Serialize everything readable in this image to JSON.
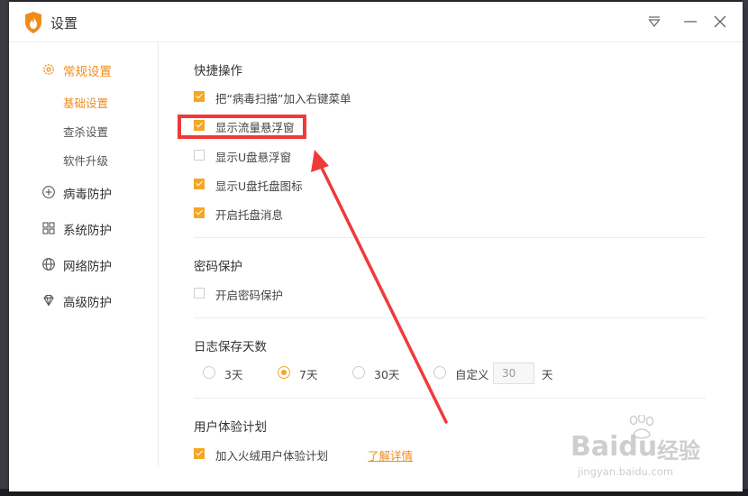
{
  "window": {
    "title": "设置"
  },
  "titlebar": {
    "menu_icon": "dropdown-menu-icon",
    "minimize_icon": "minimize-icon",
    "close_icon": "close-icon"
  },
  "sidebar": {
    "items": [
      {
        "label": "常规设置",
        "icon": "gear-icon",
        "active": true
      },
      {
        "label": "病毒防护",
        "icon": "plus-circle-icon"
      },
      {
        "label": "系统防护",
        "icon": "grid-icon"
      },
      {
        "label": "网络防护",
        "icon": "globe-icon"
      },
      {
        "label": "高级防护",
        "icon": "diamond-icon"
      }
    ],
    "subitems": [
      {
        "label": "基础设置",
        "active": true
      },
      {
        "label": "查杀设置"
      },
      {
        "label": "软件升级"
      }
    ]
  },
  "quick_ops": {
    "title": "快捷操作",
    "items": [
      {
        "label": "把“病毒扫描”加入右键菜单",
        "checked": true
      },
      {
        "label": "显示流量悬浮窗",
        "checked": true
      },
      {
        "label": "显示U盘悬浮窗",
        "checked": false
      },
      {
        "label": "显示U盘托盘图标",
        "checked": true
      },
      {
        "label": "开启托盘消息",
        "checked": true
      }
    ]
  },
  "password": {
    "title": "密码保护",
    "items": [
      {
        "label": "开启密码保护",
        "checked": false
      }
    ]
  },
  "log_days": {
    "title": "日志保存天数",
    "options": [
      {
        "label": "3天",
        "selected": false
      },
      {
        "label": "7天",
        "selected": true
      },
      {
        "label": "30天",
        "selected": false
      },
      {
        "label": "自定义",
        "selected": false
      }
    ],
    "custom_value": "30",
    "unit": "天"
  },
  "ux_plan": {
    "title": "用户体验计划",
    "items": [
      {
        "label": "加入火绒用户体验计划",
        "checked": true
      }
    ],
    "link": "了解详情"
  },
  "annotation": {
    "color": "#f03a3a"
  },
  "watermark": {
    "brand": "Baidu",
    "label": "经验",
    "url": "jingyan.baidu.com"
  },
  "colors": {
    "accent": "#f08c1a",
    "checkbox": "#f5a623"
  }
}
